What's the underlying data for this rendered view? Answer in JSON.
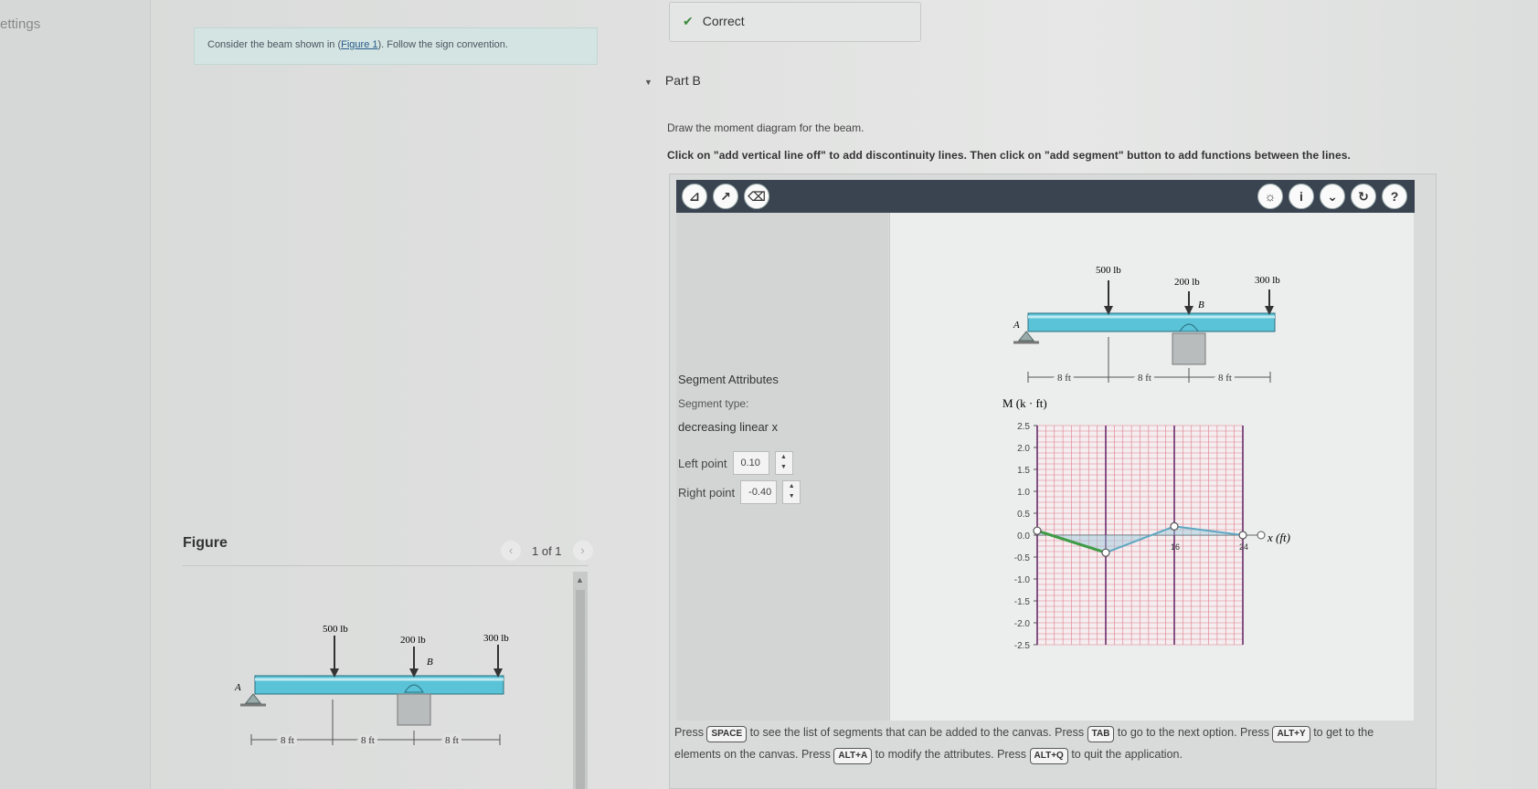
{
  "nav": {
    "settings_label": "ettings"
  },
  "problem": {
    "text_before": "Consider the beam shown in (",
    "figure_link": "Figure 1",
    "text_after": "). Follow the sign convention."
  },
  "figure_panel": {
    "title": "Figure",
    "pager": "1 of 1",
    "prev_icon": "chevron-left-icon",
    "next_icon": "chevron-right-icon"
  },
  "status": {
    "correct_label": "Correct",
    "icon": "checkmark-icon",
    "color": "#3c8a3c"
  },
  "part": {
    "label": "Part B",
    "instruction": "Draw the moment diagram for the beam.",
    "instruction2": "Click on \"add vertical line off\" to add discontinuity lines. Then click on \"add segment\" button to add functions between the lines."
  },
  "toolbar": {
    "left_tools": [
      "add-vertical-line-icon",
      "add-segment-icon",
      "trash-icon"
    ],
    "right_tools": [
      "hint-icon",
      "info-icon",
      "chevron-down-icon",
      "reset-icon",
      "help-icon"
    ],
    "help_glyph": "?",
    "info_glyph": "i"
  },
  "segment_attributes": {
    "title": "Segment Attributes",
    "type_label": "Segment type:",
    "type_value": "decreasing linear x",
    "left_point_label": "Left point",
    "left_point_value": "0.10",
    "right_point_label": "Right point",
    "right_point_value": "-0.40"
  },
  "beam": {
    "loads": [
      "500 lb",
      "200 lb",
      "300 lb"
    ],
    "support_labels": [
      "A",
      "B"
    ],
    "spans": [
      "8 ft",
      "8 ft",
      "8 ft"
    ]
  },
  "chart_data": {
    "type": "line",
    "ylabel": "M (k · ft)",
    "xlabel": "x (ft)",
    "ylim": [
      -2.5,
      2.5
    ],
    "xlim": [
      0,
      24
    ],
    "yticks": [
      "2.5",
      "2.0",
      "1.5",
      "1.0",
      "0.5",
      "0.0",
      "-0.5",
      "-1.0",
      "-1.5",
      "-2.0",
      "-2.5"
    ],
    "xticks": [
      "16",
      "24"
    ],
    "vertical_lines_x": [
      0,
      8,
      16,
      24
    ],
    "series": [
      {
        "points": [
          [
            0,
            0.1
          ],
          [
            8,
            -0.4
          ],
          [
            16,
            0.2
          ],
          [
            24,
            0.0
          ]
        ]
      }
    ],
    "highlighted_segment": [
      [
        0,
        0.1
      ],
      [
        8,
        -0.4
      ]
    ],
    "grid": true
  },
  "help": {
    "p1": "Press",
    "k1": "SPACE",
    "p2": "to see the list of segments that can be added to the canvas. Press",
    "k2": "TAB",
    "p3": "to go to the next option. Press",
    "k3": "ALT+Y",
    "p4": "to get to the elements on the canvas. Press",
    "k4": "ALT+A",
    "p5": "to modify the attributes. Press",
    "k5": "ALT+Q",
    "p6": "to quit the application."
  }
}
